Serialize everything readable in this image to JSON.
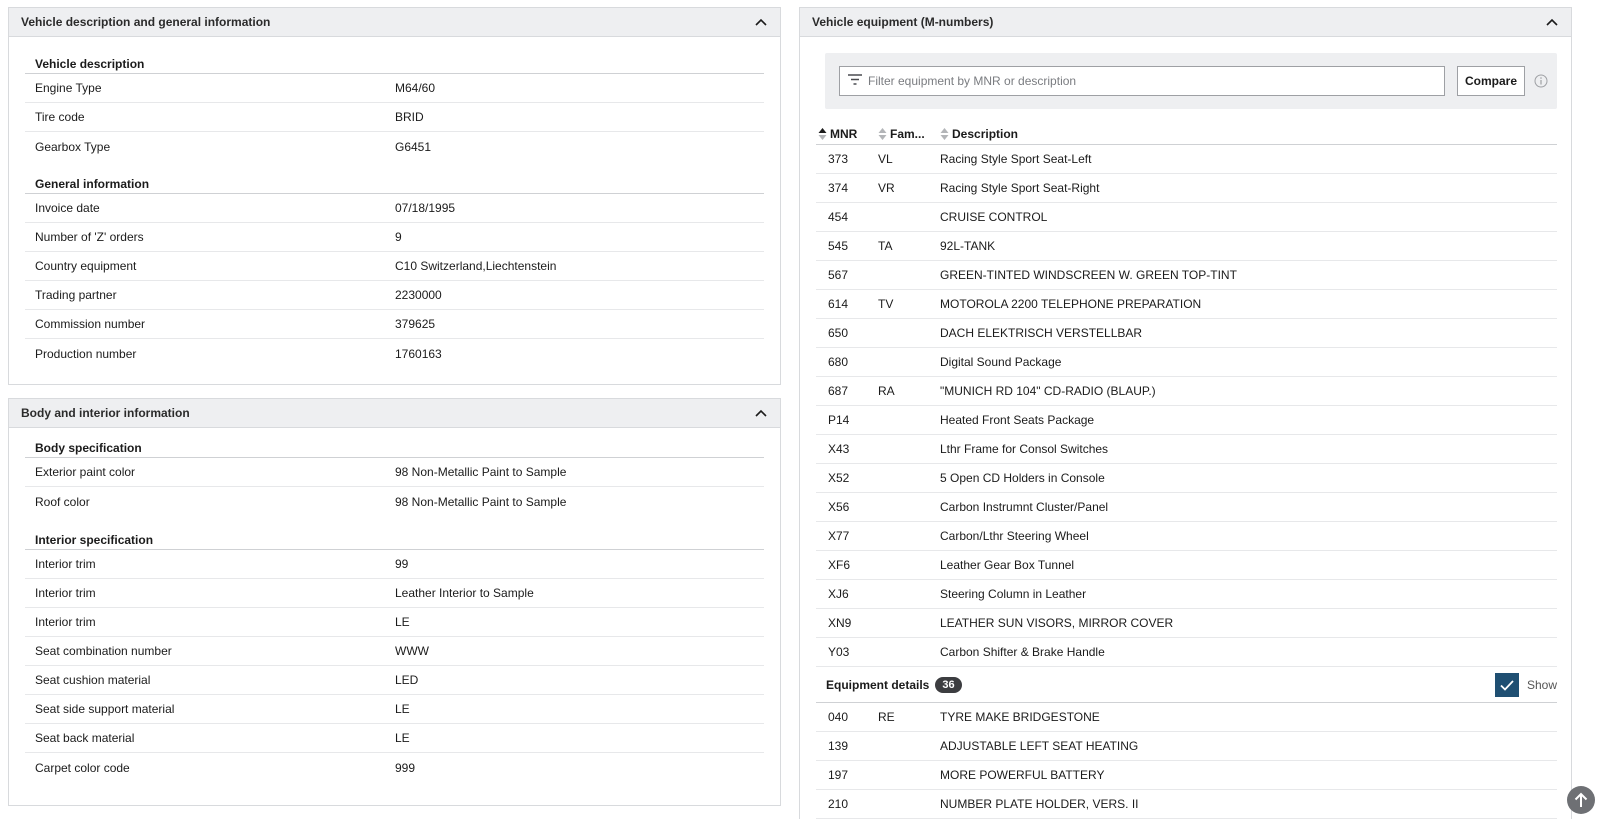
{
  "vehicle_panel": {
    "title": "Vehicle description and general information",
    "sections": [
      {
        "title": "Vehicle description",
        "rows": [
          {
            "label": "Engine Type",
            "value": "M64/60"
          },
          {
            "label": "Tire code",
            "value": "BRID"
          },
          {
            "label": "Gearbox Type",
            "value": "G6451"
          }
        ]
      },
      {
        "title": "General information",
        "rows": [
          {
            "label": "Invoice date",
            "value": "07/18/1995"
          },
          {
            "label": "Number of 'Z' orders",
            "value": "9"
          },
          {
            "label": "Country equipment",
            "value": "C10 Switzerland,Liechtenstein"
          },
          {
            "label": "Trading partner",
            "value": "2230000"
          },
          {
            "label": "Commission number",
            "value": "379625"
          },
          {
            "label": "Production number",
            "value": "1760163"
          }
        ]
      }
    ]
  },
  "body_panel": {
    "title": "Body and interior information",
    "sections": [
      {
        "title": "Body specification",
        "rows": [
          {
            "label": "Exterior paint color",
            "value": "98 Non-Metallic Paint to Sample"
          },
          {
            "label": "Roof color",
            "value": "98 Non-Metallic Paint to Sample"
          }
        ]
      },
      {
        "title": "Interior specification",
        "rows": [
          {
            "label": "Interior trim",
            "value": "99"
          },
          {
            "label": "Interior trim",
            "value": "Leather Interior to Sample"
          },
          {
            "label": "Interior trim",
            "value": "LE"
          },
          {
            "label": "Seat combination number",
            "value": "WWW"
          },
          {
            "label": "Seat cushion material",
            "value": "LED"
          },
          {
            "label": "Seat side support material",
            "value": "LE"
          },
          {
            "label": "Seat back material",
            "value": "LE"
          },
          {
            "label": "Carpet color code",
            "value": "999"
          }
        ]
      }
    ]
  },
  "equipment_panel": {
    "title": "Vehicle equipment (M-numbers)",
    "filter_placeholder": "Filter equipment by MNR or description",
    "compare_label": "Compare",
    "columns": [
      "MNR",
      "Fam...",
      "Description"
    ],
    "rows": [
      {
        "mnr": "373",
        "fam": "VL",
        "desc": "Racing Style Sport Seat-Left"
      },
      {
        "mnr": "374",
        "fam": "VR",
        "desc": "Racing Style Sport Seat-Right"
      },
      {
        "mnr": "454",
        "fam": "",
        "desc": "CRUISE CONTROL"
      },
      {
        "mnr": "545",
        "fam": "TA",
        "desc": "92L-TANK"
      },
      {
        "mnr": "567",
        "fam": "",
        "desc": "GREEN-TINTED WINDSCREEN W. GREEN TOP-TINT"
      },
      {
        "mnr": "614",
        "fam": "TV",
        "desc": "MOTOROLA 2200 TELEPHONE PREPARATION"
      },
      {
        "mnr": "650",
        "fam": "",
        "desc": "DACH ELEKTRISCH VERSTELLBAR"
      },
      {
        "mnr": "680",
        "fam": "",
        "desc": "Digital Sound Package"
      },
      {
        "mnr": "687",
        "fam": "RA",
        "desc": "\"MUNICH RD 104\" CD-RADIO (BLAUP.)"
      },
      {
        "mnr": "P14",
        "fam": "",
        "desc": "Heated Front Seats Package"
      },
      {
        "mnr": "X43",
        "fam": "",
        "desc": "Lthr Frame for Consol Switches"
      },
      {
        "mnr": "X52",
        "fam": "",
        "desc": "5 Open CD Holders in Console"
      },
      {
        "mnr": "X56",
        "fam": "",
        "desc": "Carbon Instrumnt Cluster/Panel"
      },
      {
        "mnr": "X77",
        "fam": "",
        "desc": "Carbon/Lthr Steering Wheel"
      },
      {
        "mnr": "XF6",
        "fam": "",
        "desc": "Leather Gear Box Tunnel"
      },
      {
        "mnr": "XJ6",
        "fam": "",
        "desc": "Steering Column in Leather"
      },
      {
        "mnr": "XN9",
        "fam": "",
        "desc": "LEATHER SUN VISORS, MIRROR COVER"
      },
      {
        "mnr": "Y03",
        "fam": "",
        "desc": "Carbon Shifter & Brake Handle"
      }
    ],
    "details_title": "Equipment details",
    "details_count": "36",
    "show_label": "Show",
    "show_checked": true,
    "details_rows": [
      {
        "mnr": "040",
        "fam": "RE",
        "desc": "TYRE MAKE BRIDGESTONE"
      },
      {
        "mnr": "139",
        "fam": "",
        "desc": "ADJUSTABLE LEFT SEAT HEATING"
      },
      {
        "mnr": "197",
        "fam": "",
        "desc": "MORE POWERFUL BATTERY"
      },
      {
        "mnr": "210",
        "fam": "",
        "desc": "NUMBER PLATE HOLDER, VERS. II"
      }
    ]
  },
  "icons": {
    "collapse": "chevron-up-icon",
    "filter": "filter-icon",
    "info": "info-icon",
    "sort": "sort-icon",
    "check": "check-icon",
    "scroll_top": "arrow-up-icon"
  },
  "colors": {
    "header_bg": "#eeeff1",
    "checkbox": "#1f4f72",
    "badge": "#3c3d40"
  }
}
